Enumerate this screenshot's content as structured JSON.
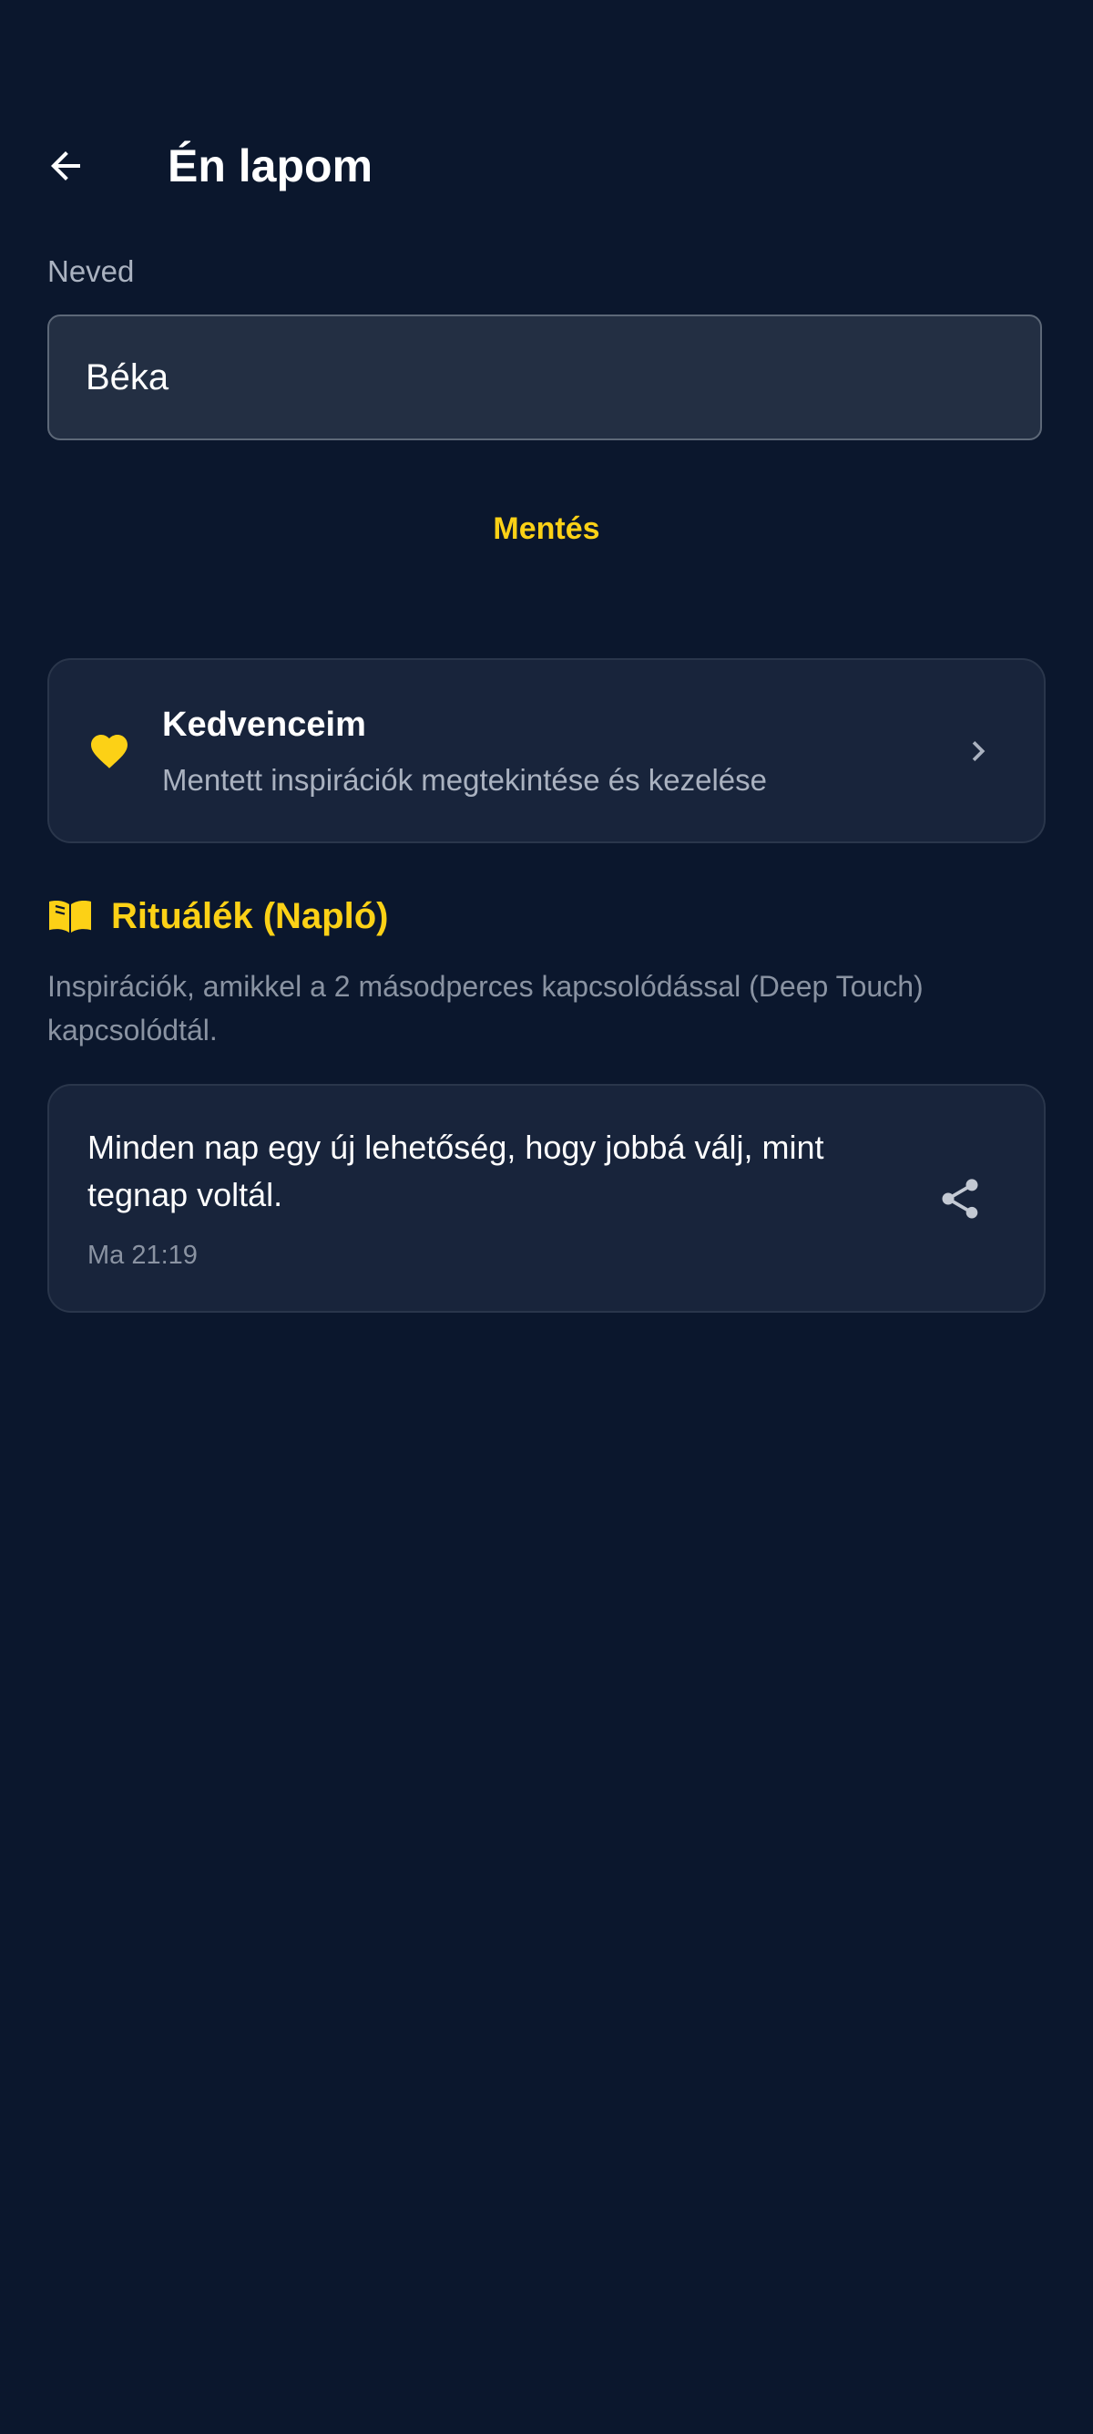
{
  "header": {
    "title": "Én lapom",
    "back_icon": "arrow-left-icon"
  },
  "name_section": {
    "label": "Neved",
    "input_value": "Béka",
    "save_label": "Mentés"
  },
  "favorites": {
    "icon": "heart-icon",
    "title": "Kedvenceim",
    "subtitle": "Mentett inspirációk megtekintése és kezelése",
    "chevron_icon": "chevron-right-icon"
  },
  "rituals": {
    "icon": "open-book-icon",
    "title": "Rituálék (Napló)",
    "description": "Inspirációk, amikkel a 2 másodperces kapcsolódással (Deep Touch) kapcsolódtál.",
    "entries": [
      {
        "text": "Minden nap egy új lehetőség, hogy jobbá válj, mint tegnap voltál.",
        "time": "Ma 21:19",
        "share_icon": "share-icon"
      }
    ]
  },
  "colors": {
    "background": "#0b172d",
    "card": "#18243b",
    "input": "#232f43",
    "accent": "#fcd116",
    "text_primary": "#ffffff",
    "text_secondary": "#aab2c0",
    "text_muted": "#8a93a2"
  }
}
